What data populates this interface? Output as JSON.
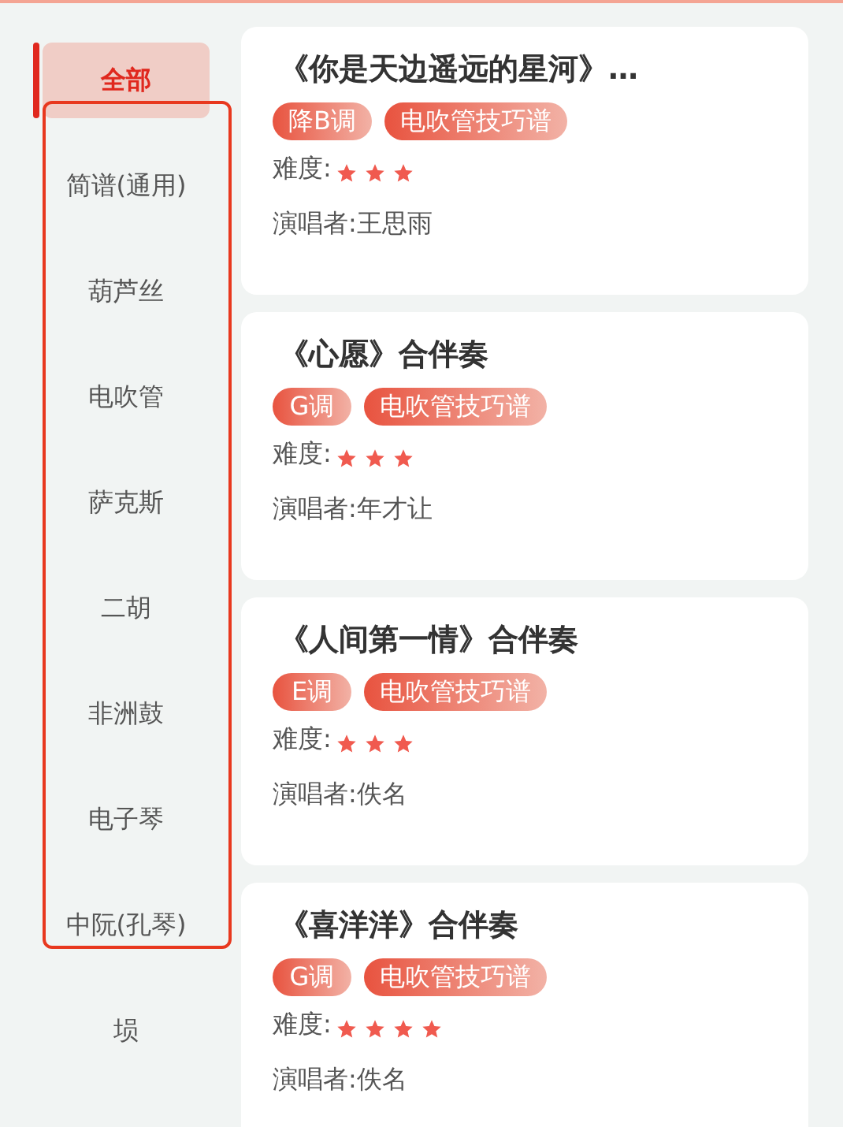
{
  "sidebar": {
    "items": [
      {
        "label": "全部",
        "selected": true
      },
      {
        "label": "简谱(通用)",
        "selected": false
      },
      {
        "label": "葫芦丝",
        "selected": false
      },
      {
        "label": "电吹管",
        "selected": false
      },
      {
        "label": "萨克斯",
        "selected": false
      },
      {
        "label": "二胡",
        "selected": false
      },
      {
        "label": "非洲鼓",
        "selected": false
      },
      {
        "label": "电子琴",
        "selected": false
      },
      {
        "label": "中阮(孔琴)",
        "selected": false
      },
      {
        "label": "埙",
        "selected": false
      }
    ]
  },
  "scores": [
    {
      "title": "《你是天边遥远的星河》…",
      "tags": [
        "降B调",
        "电吹管技巧谱"
      ],
      "difficulty_label": "难度:",
      "stars": 3,
      "singer": "演唱者:王思雨"
    },
    {
      "title": "《心愿》合伴奏",
      "tags": [
        "G调",
        "电吹管技巧谱"
      ],
      "difficulty_label": "难度:",
      "stars": 3,
      "singer": "演唱者:年才让"
    },
    {
      "title": "《人间第一情》合伴奏",
      "tags": [
        "E调",
        "电吹管技巧谱"
      ],
      "difficulty_label": "难度:",
      "stars": 3,
      "singer": "演唱者:佚名"
    },
    {
      "title": "《喜洋洋》合伴奏",
      "tags": [
        "G调",
        "电吹管技巧谱"
      ],
      "difficulty_label": "难度:",
      "stars": 4,
      "singer": "演唱者:佚名"
    }
  ]
}
